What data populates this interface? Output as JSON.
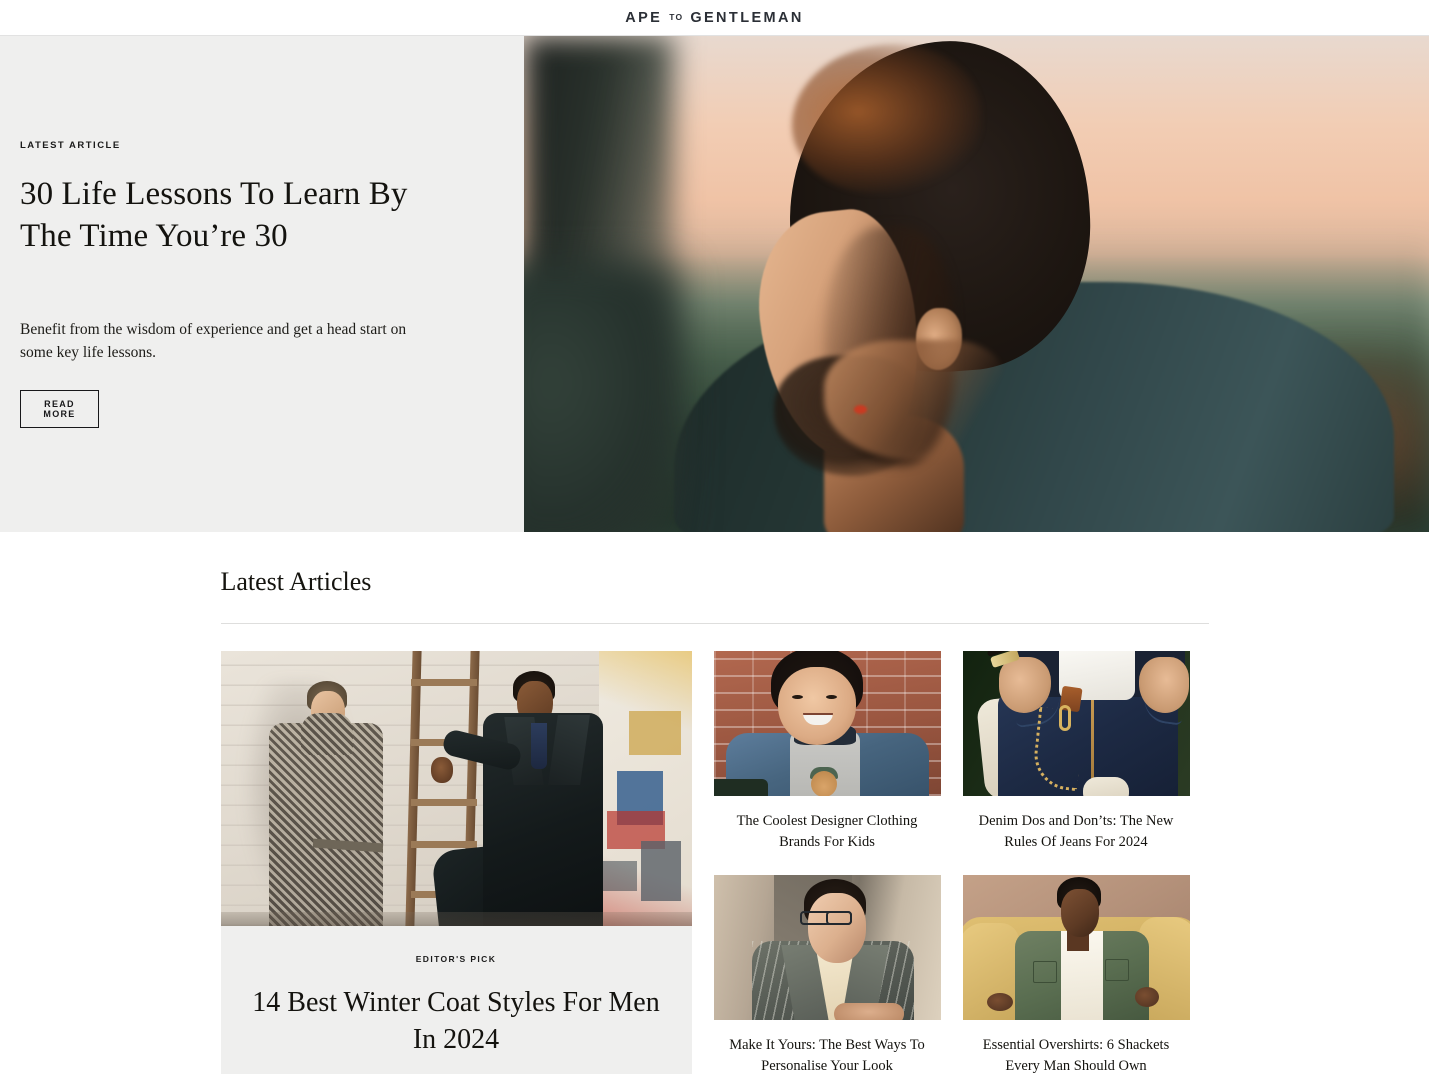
{
  "header": {
    "logo_primary": "APE",
    "logo_middle": "TO",
    "logo_secondary": "GENTLEMAN"
  },
  "hero": {
    "eyebrow": "LATEST ARTICLE",
    "title": "30 Life Lessons To Learn By The Time You’re 30",
    "dek": "Benefit from the wisdom of experience and get a head start on some key life lessons.",
    "cta_label": "READ MORE",
    "image_alt": "Man in profile at golden hour wearing a dark green jacket",
    "background_color": "#efefee"
  },
  "latest": {
    "section_title": "Latest Articles",
    "feature": {
      "eyebrow": "EDITOR'S PICK",
      "title": "14 Best Winter Coat Styles For Men In 2024",
      "image_alt": "Two men in winter coats beside a ladder against a white brick wall"
    },
    "cards": [
      {
        "title": "The Coolest Designer Clothing Brands For Kids",
        "image_alt": "Smiling child in a denim jacket in front of a brick wall"
      },
      {
        "title": "Denim Dos and Don’ts: The New Rules Of Jeans For 2024",
        "image_alt": "Close-up of dark indigo jeans with a gold wallet chain"
      },
      {
        "title": "Make It Yours: The Best Ways To Personalise Your Look",
        "image_alt": "Man in glasses wearing a pinstripe blazer and cream turtleneck"
      },
      {
        "title": "Essential Overshirts: 6 Shackets Every Man Should Own",
        "image_alt": "Man in a green overshirt seated on a yellow sofa"
      }
    ]
  }
}
